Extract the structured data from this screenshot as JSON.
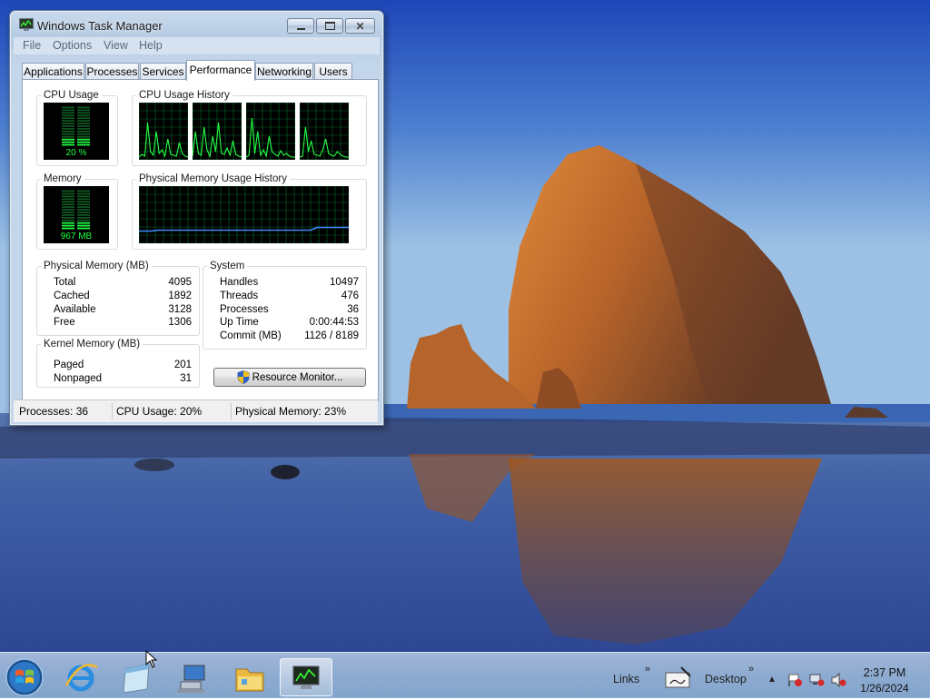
{
  "window": {
    "title": "Windows Task Manager",
    "menu": [
      "File",
      "Options",
      "View",
      "Help"
    ],
    "tabs": [
      "Applications",
      "Processes",
      "Services",
      "Performance",
      "Networking",
      "Users"
    ],
    "active_tab": "Performance"
  },
  "performance": {
    "cpu_usage": {
      "label": "CPU Usage",
      "value": "20 %",
      "level": 0.2
    },
    "cpu_history": {
      "label": "CPU Usage History",
      "cores": 4
    },
    "memory": {
      "label": "Memory",
      "value": "967 MB",
      "level": 0.23
    },
    "memory_history": {
      "label": "Physical Memory Usage History",
      "level": 0.23
    },
    "physical_memory": {
      "label": "Physical Memory (MB)",
      "rows": [
        {
          "name": "Total",
          "value": "4095"
        },
        {
          "name": "Cached",
          "value": "1892"
        },
        {
          "name": "Available",
          "value": "3128"
        },
        {
          "name": "Free",
          "value": "1306"
        }
      ]
    },
    "kernel_memory": {
      "label": "Kernel Memory (MB)",
      "rows": [
        {
          "name": "Paged",
          "value": "201"
        },
        {
          "name": "Nonpaged",
          "value": "31"
        }
      ]
    },
    "system": {
      "label": "System",
      "rows": [
        {
          "name": "Handles",
          "value": "10497"
        },
        {
          "name": "Threads",
          "value": "476"
        },
        {
          "name": "Processes",
          "value": "36"
        },
        {
          "name": "Up Time",
          "value": "0:00:44:53"
        },
        {
          "name": "Commit (MB)",
          "value": "1126 / 8189"
        }
      ]
    },
    "resource_monitor_button": "Resource Monitor..."
  },
  "statusbar": {
    "processes": "Processes: 36",
    "cpu": "CPU Usage: 20%",
    "memory": "Physical Memory: 23%"
  },
  "taskbar": {
    "pinned": [
      "start-orb-icon",
      "internet-explorer-icon",
      "notepad-icon",
      "network-computer-icon",
      "file-explorer-icon",
      "task-manager-icon"
    ],
    "links_label": "Links",
    "desktop_label": "Desktop",
    "clock": {
      "time": "2:37 PM",
      "date": "1/26/2024"
    }
  },
  "colors": {
    "graph_green": "#22ff44",
    "graph_grid": "#0b6b2a",
    "memory_line": "#3c8cff",
    "sky_top": "#1d47b8",
    "rock": "#b8642a"
  }
}
